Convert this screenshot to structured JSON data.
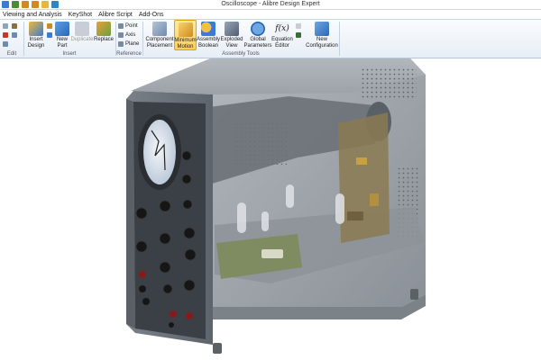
{
  "window": {
    "title": "Oscilloscope - Alibre Design Expert"
  },
  "quick_access": [
    {
      "icon": "new-file-icon",
      "color": "#3a7bd5"
    },
    {
      "icon": "save-icon",
      "color": "#4a8c3a"
    },
    {
      "icon": "undo-icon",
      "color": "#d08a20"
    },
    {
      "icon": "redo-icon",
      "color": "#d08a20"
    },
    {
      "icon": "pin-icon",
      "color": "#e2b93b"
    },
    {
      "icon": "options-icon",
      "color": "#2e86c1"
    }
  ],
  "menu": {
    "items": [
      "Viewing and Analysis",
      "KeyShot",
      "Alibre Script",
      "Add-Ons"
    ]
  },
  "ribbon": {
    "edit": {
      "group_label": "Edit"
    },
    "insert": {
      "group_label": "Insert",
      "insert_design": "Insert\nDesign",
      "new_part": "New\nPart",
      "duplicate": "Duplicate",
      "replace": "Replace"
    },
    "reference": {
      "group_label": "Reference",
      "point": "Point",
      "axis": "Axis",
      "plane": "Plane"
    },
    "assembly_tools": {
      "group_label": "Assembly Tools",
      "component_placement": "Component\nPlacement",
      "minimum_motion": "Minimum\nMotion",
      "assembly_boolean": "Assembly\nBoolean",
      "exploded_view": "Exploded\nView",
      "global_parameters": "Global\nParameters",
      "equation_editor": "Equation\nEditor",
      "new_configuration": "New\nConfiguration"
    }
  },
  "model": {
    "name": "Oscilloscope",
    "housing_color": "#8e9398",
    "frame_color": "#2a2d31",
    "pcb_color": "#6f8f55",
    "screen_color": "#dfe8f3",
    "knob_color": "#161616",
    "terminal_color": "#8a1a1a",
    "trace_color": "#222222"
  }
}
